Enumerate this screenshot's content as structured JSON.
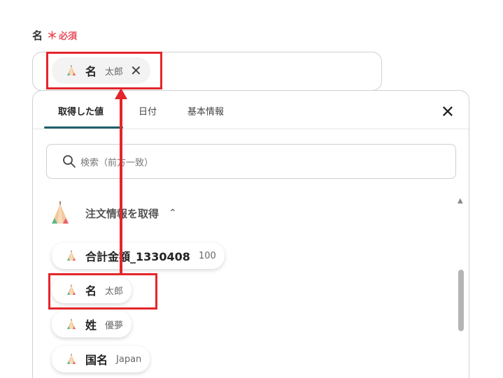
{
  "field": {
    "label": "名",
    "required_star": "＊",
    "required_text": "必須"
  },
  "selected_chip": {
    "name": "名",
    "value": "太郎",
    "close": "✕"
  },
  "tabs": [
    {
      "label": "取得した値",
      "active": true
    },
    {
      "label": "日付",
      "active": false
    },
    {
      "label": "基本情報",
      "active": false
    }
  ],
  "panel_close": "✕",
  "search": {
    "placeholder": "検索（前方一致）"
  },
  "section": {
    "title": "注文情報を取得",
    "chevron": "⌃"
  },
  "items": [
    {
      "name": "合計金額_1330408",
      "value": "100"
    },
    {
      "name": "名",
      "value": "太郎"
    },
    {
      "name": "姓",
      "value": "優夢"
    },
    {
      "name": "国名",
      "value": "Japan"
    }
  ],
  "colors": {
    "accent": "#1f5f6b",
    "required": "#e8505b",
    "annotation": "#e3262b"
  },
  "icons": {
    "item": "teepee-icon",
    "search": "search-icon",
    "close": "close-icon"
  }
}
